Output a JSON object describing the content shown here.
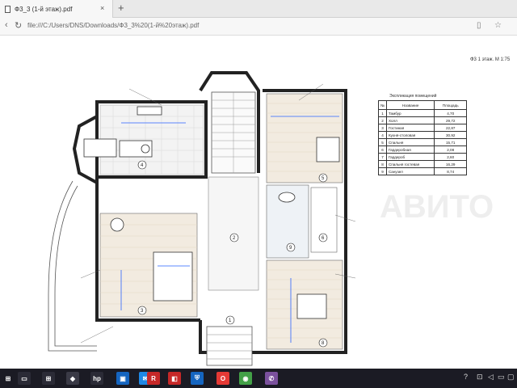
{
  "browser": {
    "tab_title": "Ф3_3 (1-й этаж).pdf",
    "tab_close": "×",
    "new_tab": "+",
    "back": "‹",
    "refresh": "↻",
    "url": "file:///C:/Users/DNS/Downloads/Ф3_3%20(1-й%20этаж).pdf",
    "reading_view": "▯",
    "favorite": "☆"
  },
  "sheet": {
    "label": "Ф3 1 этаж. М 1:75"
  },
  "explication": {
    "title": "Экспликация помещений",
    "headers": [
      "№",
      "Название",
      "Площадь"
    ],
    "rows": [
      [
        "1",
        "Тамбур",
        "4,70"
      ],
      [
        "2",
        "Холл",
        "29,72"
      ],
      [
        "3",
        "Гостиная",
        "22,87"
      ],
      [
        "4",
        "Кухня-столовая",
        "30,92"
      ],
      [
        "5",
        "Спальня",
        "15,71"
      ],
      [
        "6",
        "Гардеробная",
        "2,08"
      ],
      [
        "7",
        "Гардероб",
        "2,60"
      ],
      [
        "8",
        "Спальня гостевая",
        "16,29"
      ],
      [
        "9",
        "Санузел",
        "8,74"
      ]
    ]
  },
  "taskbar": {
    "apps": [
      {
        "name": "windows",
        "glyph": "⊞",
        "color": "#1b1b24"
      },
      {
        "name": "explorer",
        "glyph": "▭",
        "color": "#2b2b36"
      },
      {
        "name": "start-menu",
        "glyph": "⊞",
        "color": "#2b2b36"
      },
      {
        "name": "photos",
        "glyph": "◆",
        "color": "#3a3a46"
      },
      {
        "name": "hp",
        "glyph": "hp",
        "color": "#2b2b36"
      },
      {
        "name": "store",
        "glyph": "▣",
        "color": "#1565c0"
      },
      {
        "name": "mail",
        "glyph": "✉",
        "color": "#1e88e5"
      },
      {
        "name": "reader",
        "glyph": "R",
        "color": "#c62828"
      },
      {
        "name": "screen",
        "glyph": "◧",
        "color": "#c62828"
      },
      {
        "name": "security",
        "glyph": "⛨",
        "color": "#1565c0"
      },
      {
        "name": "opera",
        "glyph": "O",
        "color": "#e53935"
      },
      {
        "name": "chrome",
        "glyph": "◉",
        "color": "#43a047"
      },
      {
        "name": "viber",
        "glyph": "✆",
        "color": "#7b519d"
      }
    ],
    "tray": {
      "help": "?",
      "network": "⊡",
      "volume": "◁",
      "input": "▭",
      "chat": "▢"
    }
  }
}
